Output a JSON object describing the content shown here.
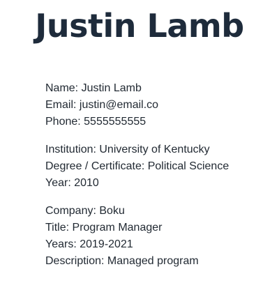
{
  "header": {
    "name": "Justin Lamb"
  },
  "contact": {
    "name": "Name: Justin Lamb",
    "email": "Email: justin@email.co",
    "phone": "Phone: 5555555555"
  },
  "education": {
    "institution": "Institution: University of Kentucky",
    "degree": "Degree / Certificate: Political Science",
    "year": "Year: 2010"
  },
  "experience": {
    "company": "Company: Boku",
    "title": "Title: Program Manager",
    "years": "Years: 2019-2021",
    "description": "Description: Managed program"
  }
}
